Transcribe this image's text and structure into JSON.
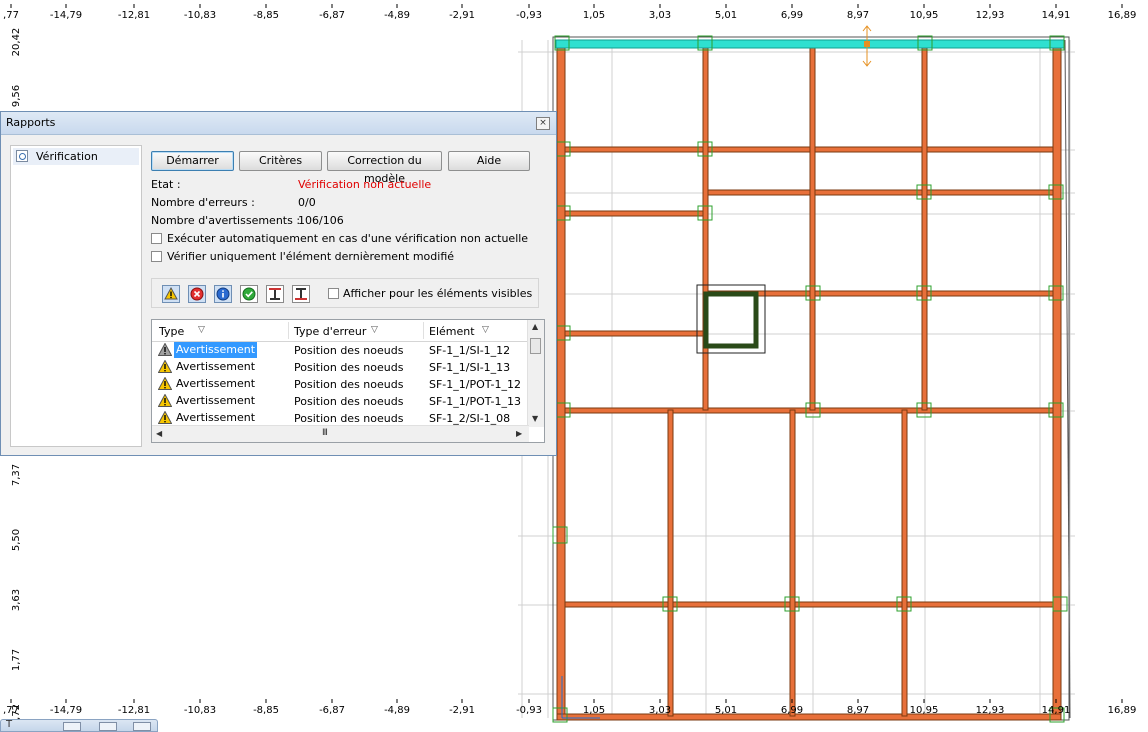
{
  "ruler": {
    "x_labels": [
      ",77",
      "-14,79",
      "-12,81",
      "-10,83",
      "-8,85",
      "-6,87",
      "-4,89",
      "-2,91",
      "-0,93",
      "1,05",
      "3,03",
      "5,01",
      "6,99",
      "8,97",
      "10,95",
      "12,93",
      "14,91",
      "16,89"
    ],
    "y_labels_top": [
      "20,42",
      "9,56"
    ],
    "y_labels_bottom": [
      "7,37",
      "5,50",
      "3,63",
      "1,77",
      ",72"
    ]
  },
  "dialog": {
    "title": "Rapports",
    "close_glyph": "×",
    "tree_item": "Vérification",
    "buttons": {
      "start": "Démarrer",
      "criteria": "Critères",
      "model_fix": "Correction du modèle",
      "help": "Aide"
    },
    "status": {
      "state_label": "Etat :",
      "state_value": "Vérification non actuelle",
      "errors_label": "Nombre d'erreurs :",
      "errors_value": "0/0",
      "warnings_label": "Nombre d'avertissements :",
      "warnings_value": "106/106"
    },
    "options": {
      "auto_run": "Exécuter automatiquement en cas d'une vérification non actuelle",
      "last_element": "Vérifier uniquement l'élément dernièrement modifié"
    },
    "visible_only": "Afficher pour les éléments visibles",
    "columns": [
      "Type",
      "Type d'erreur",
      "Elément"
    ],
    "sort_glyph": "▽",
    "rows": [
      {
        "type": "Avertissement",
        "error": "Position des noeuds",
        "element": "SF-1_1/SI-1_12"
      },
      {
        "type": "Avertissement",
        "error": "Position des noeuds",
        "element": "SF-1_1/SI-1_13"
      },
      {
        "type": "Avertissement",
        "error": "Position des noeuds",
        "element": "SF-1_1/POT-1_12"
      },
      {
        "type": "Avertissement",
        "error": "Position des noeuds",
        "element": "SF-1_1/POT-1_13"
      },
      {
        "type": "Avertissement",
        "error": "Position des noeuds",
        "element": "SF-1_2/SI-1_08"
      }
    ],
    "hscroll_grip": "III"
  },
  "taskbar": {
    "label": "T"
  },
  "colors": {
    "beam_brown": "#7a3a10",
    "beam_orange": "#e0602a",
    "highlight_cyan": "#2fe0d0",
    "node_green": "#2ca02c",
    "selected_row": "#3399ff",
    "warning_red": "#e00000"
  }
}
